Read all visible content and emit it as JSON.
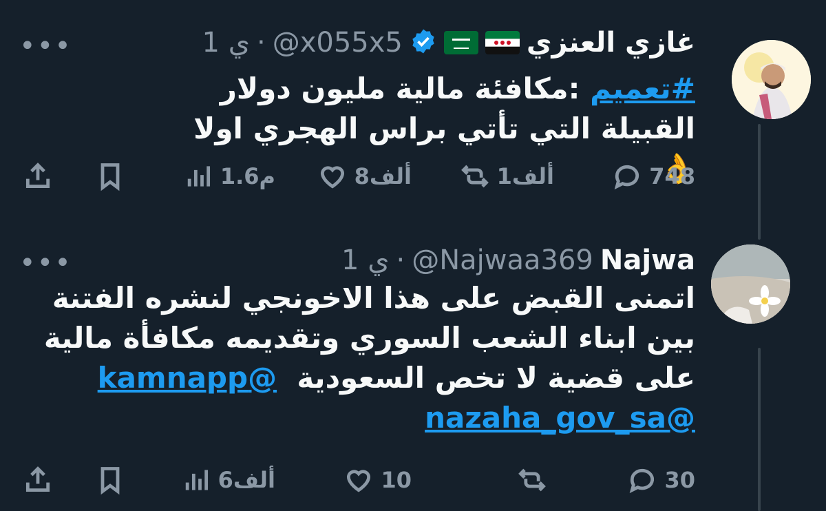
{
  "tweets": [
    {
      "display_name": "غازي العنزي",
      "handle": "@x055x5",
      "dot": "·",
      "time": "1 ي",
      "text_tag": "#تعميم",
      "text_line1_rest": " :مكافئة مالية مليون دولار",
      "text_line2": "القبيلة التي تأتي براس الهجري اولا",
      "emoji": "👌",
      "replies": "748",
      "retweets": "1ألف",
      "likes": "8ألف",
      "views": "1.6م"
    },
    {
      "display_name": "Najwa",
      "handle": "@Najwaa369",
      "dot": "·",
      "time": "1 ي",
      "text_line1": "اتمنى القبض على هذا الاخونجي لنشره الفتنة",
      "text_line2": "بين ابناء الشعب السوري وتقديمه مكافأة مالية",
      "text_line3": "على قضية لا تخص السعودية",
      "mention1": "@kamnapp",
      "mention2": "@nazaha_gov_sa",
      "replies": "30",
      "retweets": "",
      "likes": "10",
      "views": "6ألف"
    }
  ],
  "more_label": "•••",
  "colors": {
    "background": "#15202b",
    "link": "#1d9bf0",
    "muted": "#8b98a5"
  }
}
